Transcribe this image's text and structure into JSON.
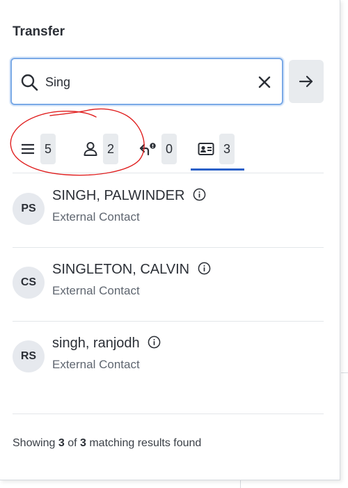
{
  "panel": {
    "title": "Transfer"
  },
  "search": {
    "value": "Sing",
    "placeholder": ""
  },
  "tabs": [
    {
      "id": "all",
      "icon": "menu-icon",
      "count": "5"
    },
    {
      "id": "users",
      "icon": "person-icon",
      "count": "2"
    },
    {
      "id": "queues",
      "icon": "queue-transfer-icon",
      "count": "0"
    },
    {
      "id": "contacts",
      "icon": "contact-card-icon",
      "count": "3",
      "selected": true
    }
  ],
  "results": [
    {
      "initials": "PS",
      "name": "SINGH, PALWINDER",
      "type": "External Contact"
    },
    {
      "initials": "CS",
      "name": "SINGLETON, CALVIN",
      "type": "External Contact"
    },
    {
      "initials": "RS",
      "name": "singh, ranjodh",
      "type": "External Contact"
    }
  ],
  "footer": {
    "prefix": "Showing",
    "shown": "3",
    "of": "of",
    "total": "3",
    "suffix": "matching results found"
  },
  "colors": {
    "accent": "#2a60c8",
    "focus_border": "#7aa9e6",
    "annotation": "#e02020",
    "chip_bg": "#e8ebee"
  }
}
